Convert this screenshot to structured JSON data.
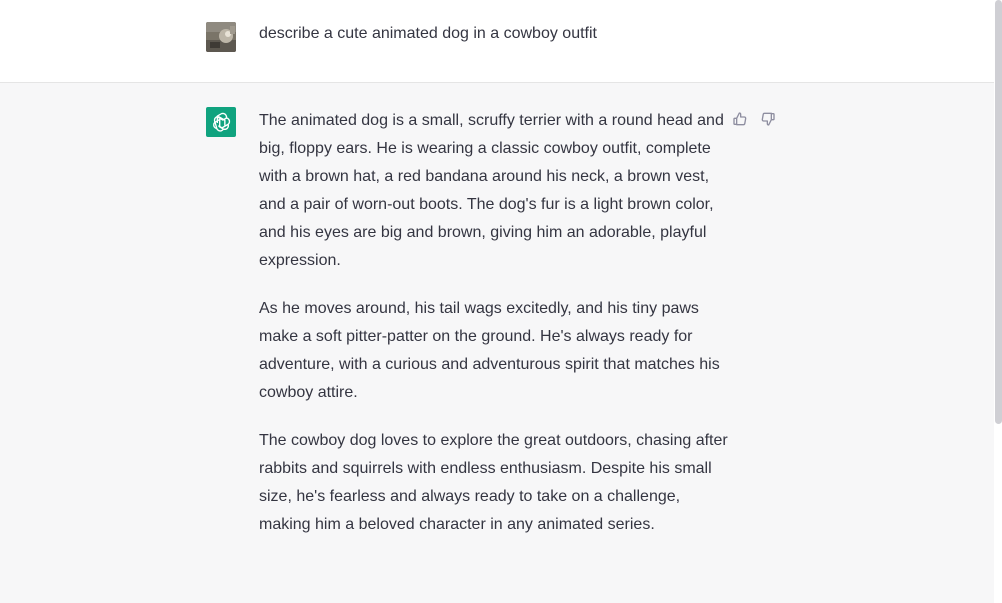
{
  "conversation": {
    "user_message": {
      "avatar": "user-photo-avatar",
      "text": "describe a cute animated dog in a cowboy outfit"
    },
    "assistant_message": {
      "avatar": "openai-logo-icon",
      "avatar_color": "#10a37f",
      "paragraphs": [
        "The animated dog is a small, scruffy terrier with a round head and big, floppy ears. He is wearing a classic cowboy outfit, complete with a brown hat, a red bandana around his neck, a brown vest, and a pair of worn-out boots. The dog's fur is a light brown color, and his eyes are big and brown, giving him an adorable, playful expression.",
        "As he moves around, his tail wags excitedly, and his tiny paws make a soft pitter-patter on the ground. He's always ready for adventure, with a curious and adventurous spirit that matches his cowboy attire.",
        "The cowboy dog loves to explore the great outdoors, chasing after rabbits and squirrels with endless enthusiasm. Despite his small size, he's fearless and always ready to take on a challenge, making him a beloved character in any animated series."
      ],
      "feedback": {
        "thumbs_up_icon": "thumbs-up-icon",
        "thumbs_down_icon": "thumbs-down-icon"
      }
    }
  },
  "colors": {
    "assistant_bg": "#f7f7f8",
    "text": "#343541",
    "brand": "#10a37f"
  }
}
